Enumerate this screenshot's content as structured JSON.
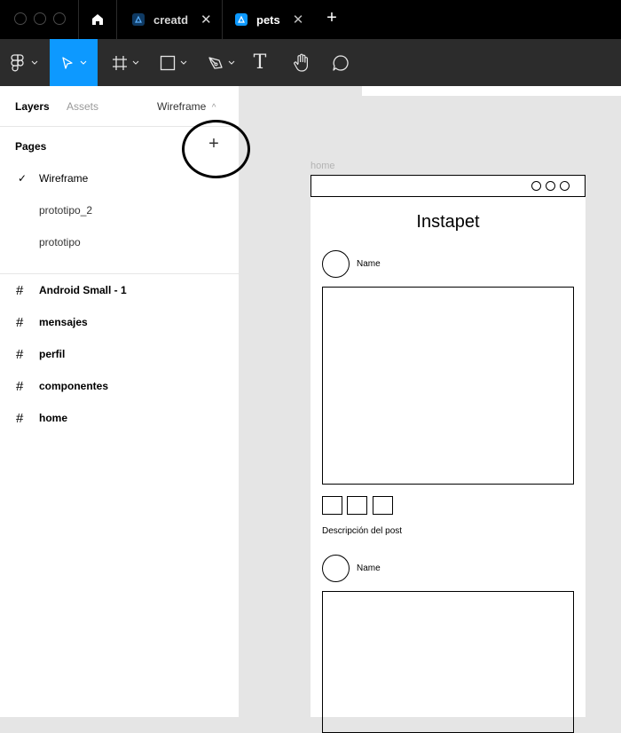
{
  "tabs": [
    {
      "title": "creatd",
      "close": "✕",
      "active": false
    },
    {
      "title": "pets",
      "close": "✕",
      "active": true
    }
  ],
  "tab_add": "+",
  "toolbar": {
    "text_tool_glyph": "T"
  },
  "panel": {
    "tab_layers": "Layers",
    "tab_assets": "Assets",
    "current_page": "Wireframe",
    "current_page_caret": "^",
    "pages_heading": "Pages",
    "add_page": "+",
    "pages": [
      {
        "label": "Wireframe",
        "selected": true
      },
      {
        "label": "prototipo_2",
        "selected": false
      },
      {
        "label": "prototipo",
        "selected": false
      }
    ],
    "check": "✓",
    "layers": [
      {
        "label": "Android Small - 1"
      },
      {
        "label": "mensajes"
      },
      {
        "label": "perfil"
      },
      {
        "label": "componentes"
      },
      {
        "label": "home"
      }
    ],
    "hash": "#"
  },
  "canvas": {
    "frame_label": "home",
    "app_title": "Instapet",
    "posts": [
      {
        "name": "Name"
      },
      {
        "name": "Name"
      }
    ],
    "description": "Descripción del post"
  },
  "colors": {
    "accent": "#0d99ff",
    "tab_bg": "#000000",
    "toolbar_bg": "#2c2c2c",
    "canvas_bg": "#e5e5e5"
  }
}
